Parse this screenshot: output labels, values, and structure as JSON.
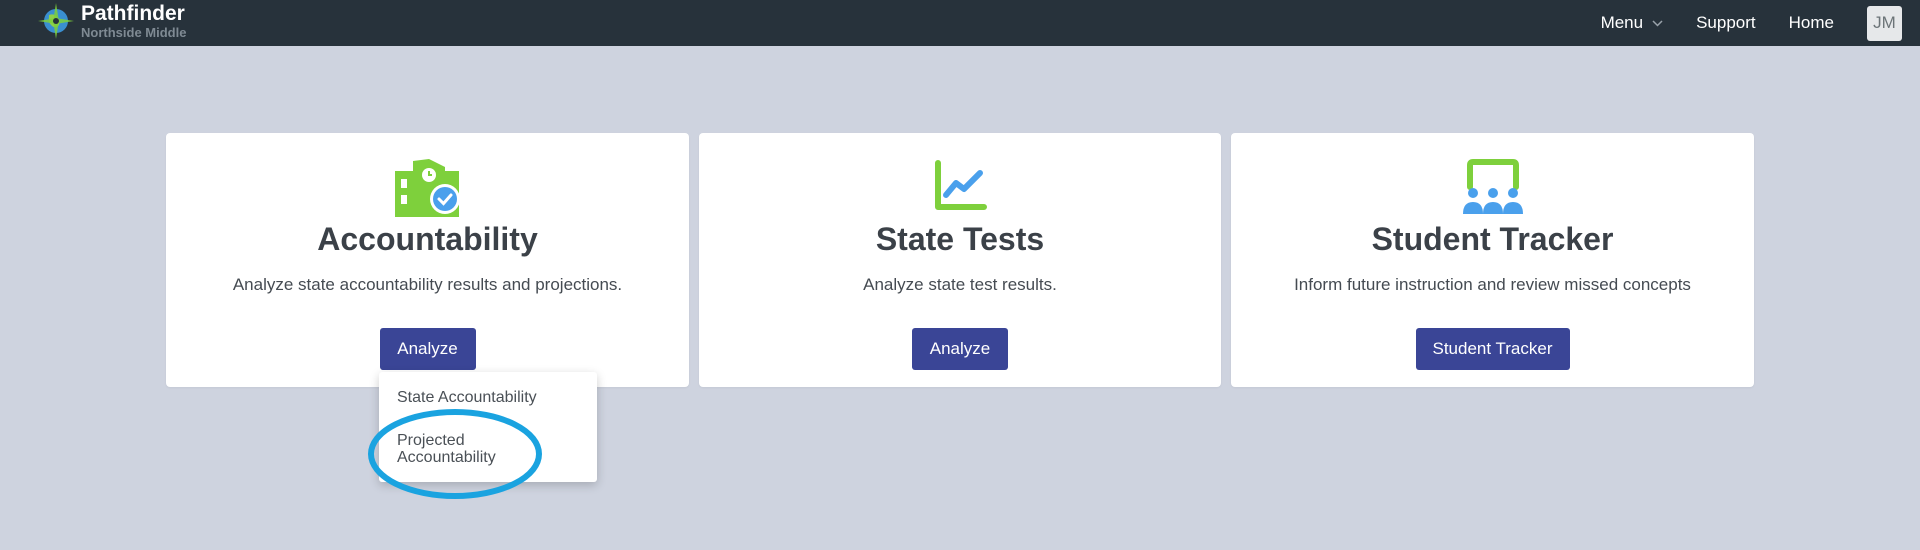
{
  "app": {
    "name": "Pathfinder",
    "school": "Northside Middle"
  },
  "nav": {
    "menu_label": "Menu",
    "support_label": "Support",
    "home_label": "Home",
    "avatar_initials": "JM"
  },
  "cards": [
    {
      "icon": "school-check-icon",
      "title": "Accountability",
      "description": "Analyze state accountability results and projections.",
      "button_label": "Analyze"
    },
    {
      "icon": "line-chart-icon",
      "title": "State Tests",
      "description": "Analyze state test results.",
      "button_label": "Analyze"
    },
    {
      "icon": "classroom-icon",
      "title": "Student Tracker",
      "description": "Inform future instruction and review missed concepts",
      "button_label": "Student Tracker"
    }
  ],
  "dropdown": {
    "items": [
      "State Accountability",
      "Projected Accountability"
    ]
  },
  "colors": {
    "topbar": "#27323b",
    "background": "#ced3df",
    "button": "#3a4596",
    "icon_green": "#7ed03c",
    "icon_blue": "#4aa0ec",
    "annotation": "#1aa3e0"
  }
}
